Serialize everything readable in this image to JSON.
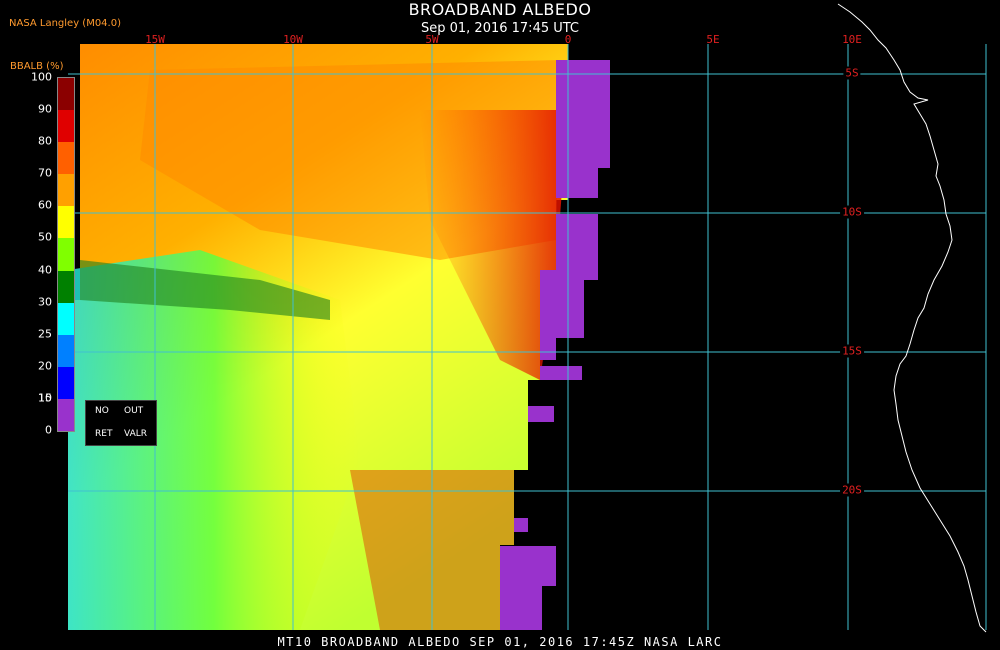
{
  "header": {
    "title": "BROADBAND ALBEDO",
    "subtitle": "Sep 01, 2016 17:45 UTC",
    "credit": "NASA Langley (M04.0)"
  },
  "footer": {
    "text": "MT10  BROADBAND ALBEDO  SEP 01, 2016 17:45Z  NASA LARC"
  },
  "legend": {
    "title": "BBALB (%)",
    "ticks": [
      "100",
      "90",
      "80",
      "70",
      "60",
      "50",
      "40",
      "30",
      "25",
      "20",
      "15",
      "10",
      "0"
    ],
    "colors": [
      "#8b0000",
      "#e00000",
      "#ff6000",
      "#ffa000",
      "#ffff00",
      "#80ff00",
      "#008000",
      "#00ffff",
      "#0080ff",
      "#0000ff",
      "#9932cc"
    ],
    "no_ret_labels": [
      "NO",
      "OUT",
      "RET",
      "VALR"
    ]
  },
  "map": {
    "lon_labels": [
      "15W",
      "10W",
      "5W",
      "0",
      "5E",
      "10E"
    ],
    "lat_labels": [
      "5S",
      "10S",
      "15S",
      "20S"
    ],
    "grid_color": "#40c0d0",
    "label_color": "#e02020",
    "coast_color": "#ffffff",
    "no_retrieval_color": "#9932cc"
  }
}
